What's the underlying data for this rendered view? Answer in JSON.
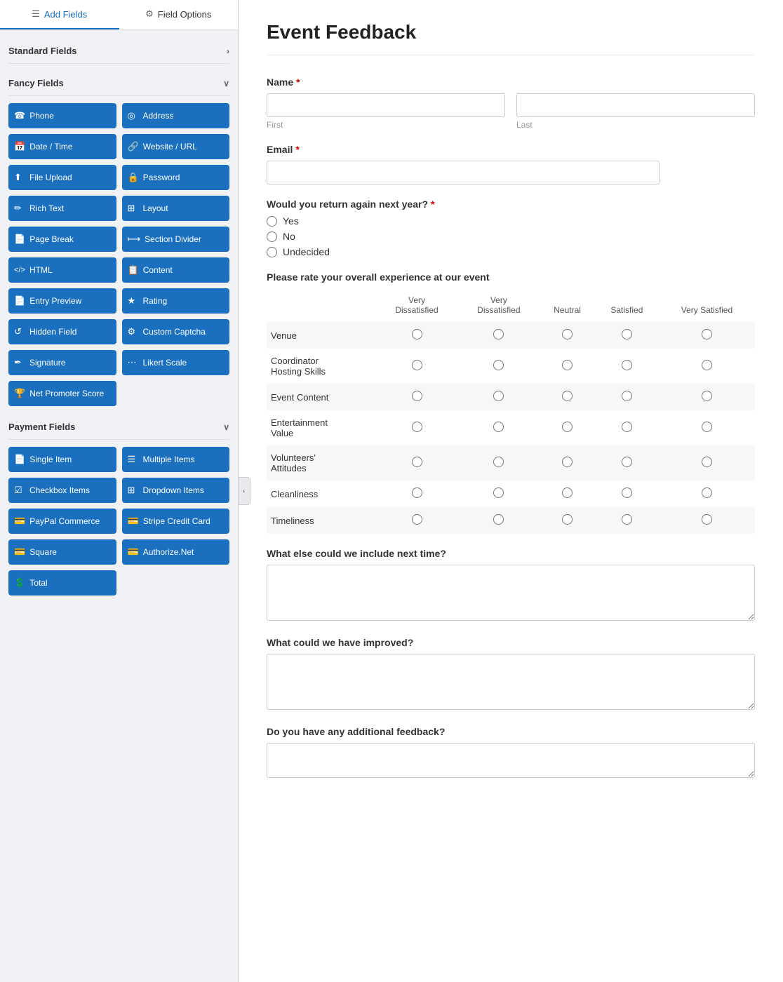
{
  "tabs": [
    {
      "id": "add-fields",
      "label": "Add Fields",
      "icon": "☰",
      "active": true
    },
    {
      "id": "field-options",
      "label": "Field Options",
      "icon": "⚙",
      "active": false
    }
  ],
  "standard_fields": {
    "label": "Standard Fields",
    "collapsed": false
  },
  "fancy_fields": {
    "label": "Fancy Fields",
    "collapsed": false,
    "items": [
      {
        "id": "phone",
        "label": "Phone",
        "icon": "📞"
      },
      {
        "id": "address",
        "label": "Address",
        "icon": "📍"
      },
      {
        "id": "datetime",
        "label": "Date / Time",
        "icon": "📅"
      },
      {
        "id": "website",
        "label": "Website / URL",
        "icon": "🔗"
      },
      {
        "id": "file-upload",
        "label": "File Upload",
        "icon": "⬆"
      },
      {
        "id": "password",
        "label": "Password",
        "icon": "🔒"
      },
      {
        "id": "rich-text",
        "label": "Rich Text",
        "icon": "✏"
      },
      {
        "id": "layout",
        "label": "Layout",
        "icon": "▦"
      },
      {
        "id": "page-break",
        "label": "Page Break",
        "icon": "📄"
      },
      {
        "id": "section-divider",
        "label": "Section Divider",
        "icon": "⟼"
      },
      {
        "id": "html",
        "label": "HTML",
        "icon": "<>"
      },
      {
        "id": "content",
        "label": "Content",
        "icon": "📋"
      },
      {
        "id": "entry-preview",
        "label": "Entry Preview",
        "icon": "📄"
      },
      {
        "id": "rating",
        "label": "Rating",
        "icon": "★"
      },
      {
        "id": "hidden-field",
        "label": "Hidden Field",
        "icon": "⟳"
      },
      {
        "id": "custom-captcha",
        "label": "Custom Captcha",
        "icon": "⚙"
      },
      {
        "id": "signature",
        "label": "Signature",
        "icon": "✒"
      },
      {
        "id": "likert-scale",
        "label": "Likert Scale",
        "icon": "⋯"
      },
      {
        "id": "net-promoter-score",
        "label": "Net Promoter Score",
        "icon": "🏆",
        "single": true
      }
    ]
  },
  "payment_fields": {
    "label": "Payment Fields",
    "collapsed": false,
    "items": [
      {
        "id": "single-item",
        "label": "Single Item",
        "icon": "📄"
      },
      {
        "id": "multiple-items",
        "label": "Multiple Items",
        "icon": "☰"
      },
      {
        "id": "checkbox-items",
        "label": "Checkbox Items",
        "icon": "☑"
      },
      {
        "id": "dropdown-items",
        "label": "Dropdown Items",
        "icon": "▦"
      },
      {
        "id": "paypal-commerce",
        "label": "PayPal Commerce",
        "icon": "💳"
      },
      {
        "id": "stripe-credit-card",
        "label": "Stripe Credit Card",
        "icon": "💳"
      },
      {
        "id": "square",
        "label": "Square",
        "icon": "💳"
      },
      {
        "id": "authorize-net",
        "label": "Authorize.Net",
        "icon": "💳"
      },
      {
        "id": "total",
        "label": "Total",
        "icon": "💲",
        "single": true
      }
    ]
  },
  "form": {
    "title": "Event Feedback",
    "fields": {
      "name_label": "Name",
      "name_first_placeholder": "",
      "name_first_sublabel": "First",
      "name_last_placeholder": "",
      "name_last_sublabel": "Last",
      "email_label": "Email",
      "return_question": "Would you return again next year?",
      "return_options": [
        "Yes",
        "No",
        "Undecided"
      ],
      "rating_section_title": "Please rate your overall experience at our event",
      "rating_columns": [
        "Very Dissatisfied",
        "Very Dissatisfied",
        "Neutral",
        "Satisfied",
        "Very Satisfied"
      ],
      "rating_col_headers": [
        "Very\nDissatisfied",
        "Very\nDissatisfied",
        "Neutral",
        "Satisfied",
        "Very Satisfied"
      ],
      "rating_rows": [
        "Venue",
        "Coordinator Hosting Skills",
        "Event Content",
        "Entertainment Value",
        "Volunteers' Attitudes",
        "Cleanliness",
        "Timeliness"
      ],
      "textarea1_label": "What else could we include next time?",
      "textarea2_label": "What could we have improved?",
      "textarea3_label": "Do you have any additional feedback?"
    }
  }
}
